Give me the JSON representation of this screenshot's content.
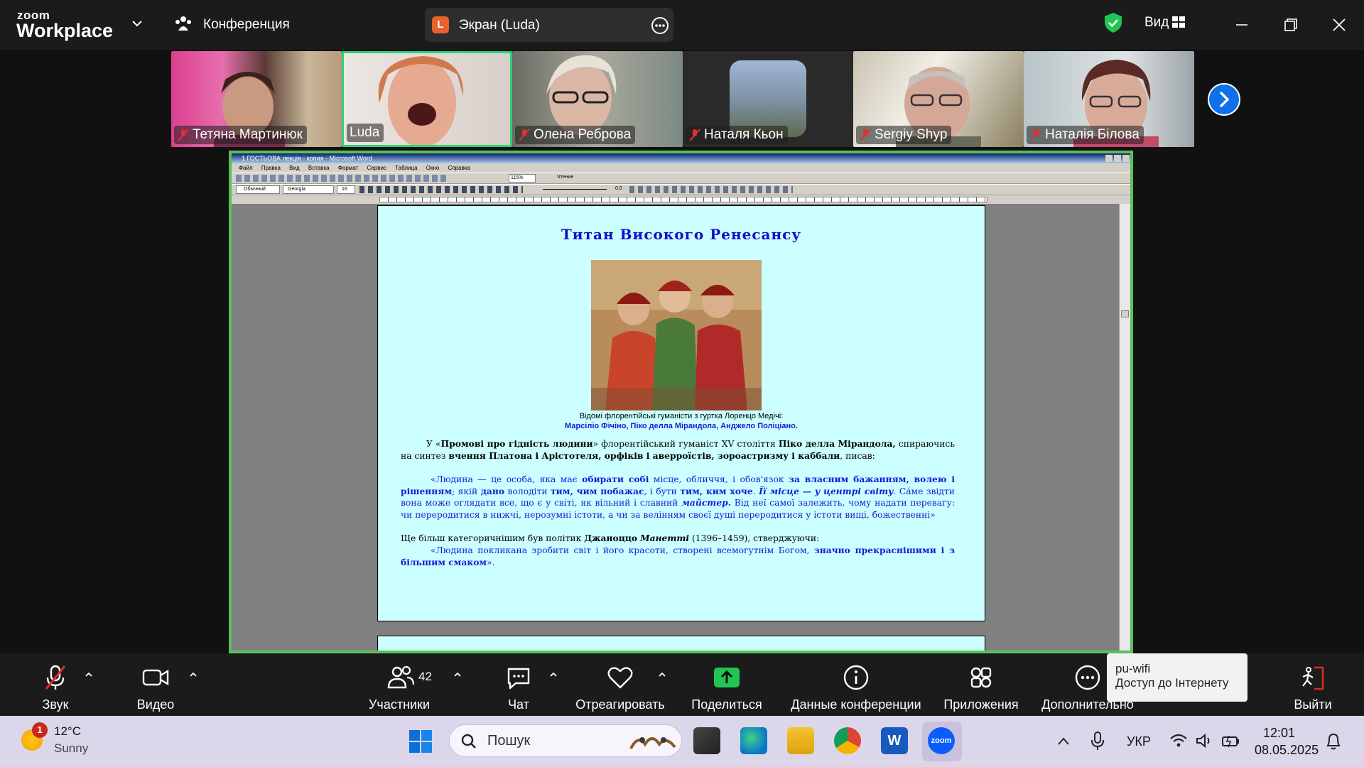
{
  "topbar": {
    "logo_line1": "zoom",
    "logo_line2": "Workplace",
    "conference_label": "Конференция",
    "share_pill": {
      "avatar_letter": "L",
      "label": "Экран (Luda)"
    },
    "view_label": "Вид"
  },
  "participants": [
    {
      "name": "Тетяна Мартинюк",
      "muted": true
    },
    {
      "name": "Luda",
      "muted": false,
      "active_speaker": true
    },
    {
      "name": "Олена Реброва",
      "muted": true
    },
    {
      "name": "Наталя Кьон",
      "muted": true
    },
    {
      "name": "Sergiy Shyp",
      "muted": true
    },
    {
      "name": "Наталія Білова",
      "muted": true
    }
  ],
  "word": {
    "window_title": "1 ГОСТЬОВА лекція - копия - Microsoft Word",
    "menu": [
      "Файл",
      "Правка",
      "Вид",
      "Вставка",
      "Формат",
      "Сервис",
      "Таблица",
      "Окно",
      "Справка"
    ],
    "style_box": "Обычный",
    "font_box": "Georgia",
    "size_box": "16",
    "zoom_box": "115%",
    "reading_btn": "Чтение",
    "line_weight": "0,5",
    "document": {
      "title": "Титан Високого Ренесансу",
      "caption_line1": "Відомі флорентійські гуманісти з гуртка Лоренцо Медічі:",
      "caption_line2": "Марсіліо Фічіно, Піко делла Мірандола, Анджело Поліціано.",
      "p1_a": "У «",
      "p1_b": "Промові про гідність людини",
      "p1_c": "» флорентійський гуманіст XV століття ",
      "p1_d": "Піко делла Мірандола,",
      "p1_e": " спираючись на синтез ",
      "p1_f": "вчення Платона і Арістотеля, орфіків і аверроїстів, зороастризму і каббали",
      "p1_g": ", писав:",
      "q1_a": "«Людина — це особа, яка має ",
      "q1_b": "обирати собі",
      "q1_c": " місце, обличчя, і обов'язок ",
      "q1_d": "за власним бажанням, волею і рішенням",
      "q1_e": "; якій ",
      "q1_f": "дано",
      "q1_g": " володіти ",
      "q1_h": "тим, чим побажає",
      "q1_i": ", і бути ",
      "q1_j": "тим, ким хоче",
      "q1_k": ". ",
      "q1_l": "Її місце — у центрі світу",
      "q1_m": ". Са́ме звідти вона може оглядати все, що є у світі, як вільний і славний ",
      "q1_n": "майстер.",
      "q1_o": " Від неї самої залежить, чому надати перевагу: чи переродитися в нижчі, нерозумні істоти, а чи за велінням своєї душі переродитися у істоти вищі, божественні»",
      "p2_a": "Ще більш категоричнішим був політик ",
      "p2_b": "Джаноццо",
      "p2_c": " ",
      "p2_d": "Манетті",
      "p2_e": " (1396–1459), стверджуючи:",
      "q2_a": "«Людина покликана зробити світ і його красоти, створені всемогутнім Богом, ",
      "q2_b": "значно прекраснішими і з більшим смаком",
      "q2_c": "»."
    }
  },
  "toolbar": {
    "audio": "Звук",
    "video": "Видео",
    "participants": "Участники",
    "participants_count": "42",
    "chat": "Чат",
    "react": "Отреагировать",
    "share": "Поделиться",
    "info": "Данные конференции",
    "apps": "Приложения",
    "more": "Дополнительно",
    "leave": "Выйти"
  },
  "tooltip": {
    "line1": "pu-wifi",
    "line2": "Доступ до Інтернету"
  },
  "taskbar": {
    "weather_badge": "1",
    "weather_temp": "12°C",
    "weather_desc": "Sunny",
    "search_placeholder": "Пошук",
    "lang": "УКР",
    "time": "12:01",
    "date": "08.05.2025"
  },
  "colors": {
    "accent_blue": "#0e71eb",
    "speaker_border": "#5ac05a",
    "doc_bg": "#ccffff",
    "doc_blue": "#1a1ad8",
    "share_green": "#23c552",
    "leave_red": "#e02828"
  }
}
